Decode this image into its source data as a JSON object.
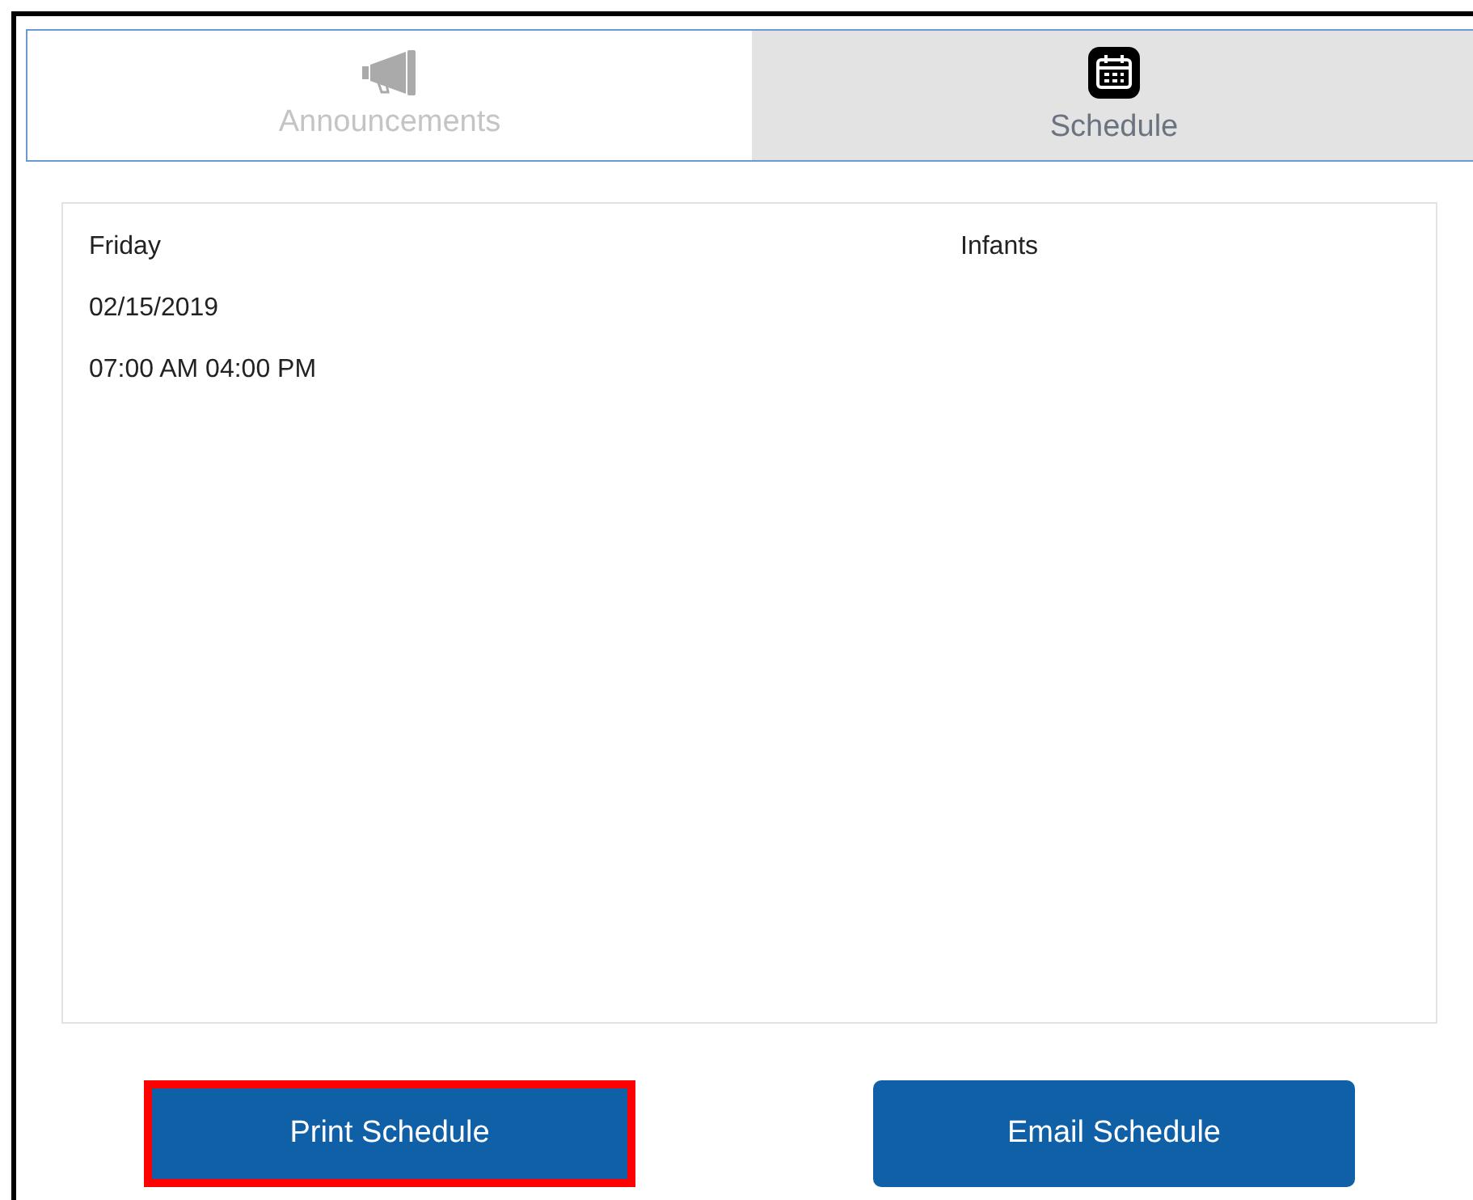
{
  "tabs": [
    {
      "label": "Announcements",
      "kind": "megaphone",
      "selected": false
    },
    {
      "label": "Schedule",
      "kind": "calendar",
      "selected": true
    }
  ],
  "schedule": {
    "day": "Friday",
    "date": "02/15/2019",
    "hours": "07:00 AM 04:00 PM",
    "room": "Infants"
  },
  "buttons": [
    {
      "label": "Print Schedule",
      "highlighted": true
    },
    {
      "label": "Email Schedule",
      "highlighted": false
    }
  ]
}
